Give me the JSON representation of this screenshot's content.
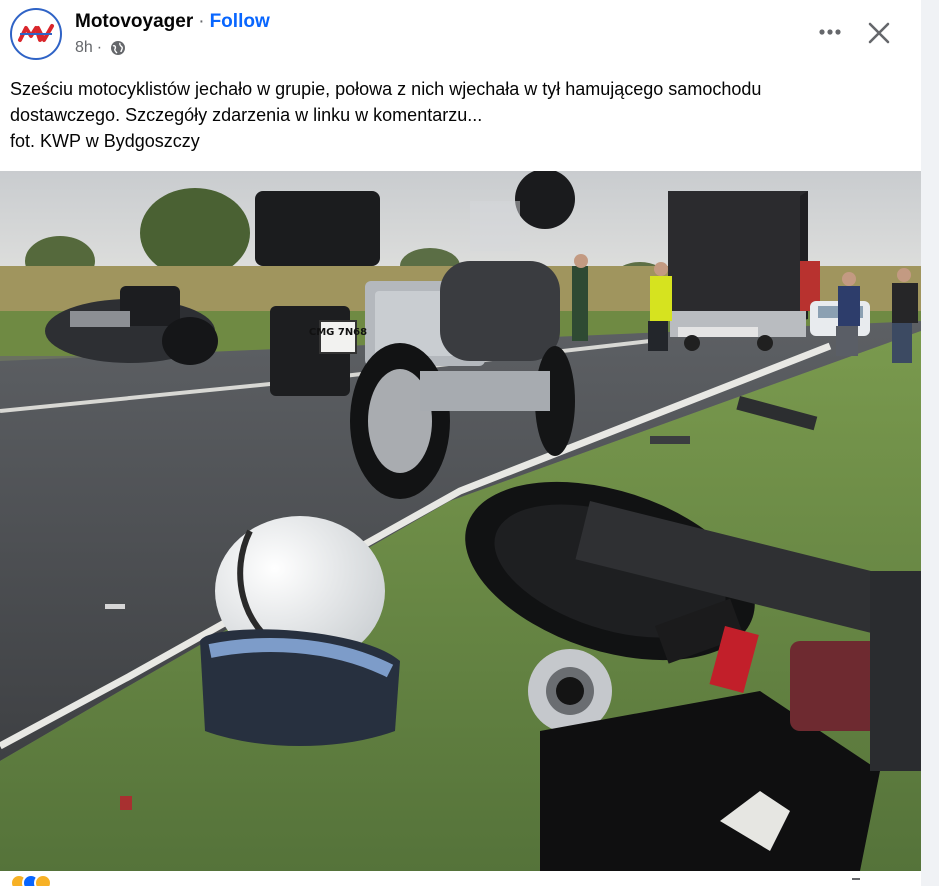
{
  "post": {
    "page_name": "Motovoyager",
    "separator": "·",
    "follow_label": "Follow",
    "time": "8h",
    "time_separator": "·",
    "privacy_icon": "globe-icon",
    "more_icon": "more-dots-icon",
    "close_icon": "close-icon",
    "text_lines": [
      "Sześciu motocyklistów jechało w grupie, połowa z nich wjechała w tył hamującego samochodu",
      "dostawczego. Szczegóły zdarzenia w linku w komentarzu...",
      "fot. KWP w Bydgoszczy"
    ],
    "photo": {
      "plate_text": "CMG 7N68"
    },
    "reactions": [
      "haha",
      "like",
      "wow"
    ]
  },
  "colors": {
    "link_blue": "#0866ff",
    "text_primary": "#050505",
    "text_secondary": "#65676b",
    "logo_red": "#d9262c",
    "logo_blue": "#2f63c6"
  }
}
